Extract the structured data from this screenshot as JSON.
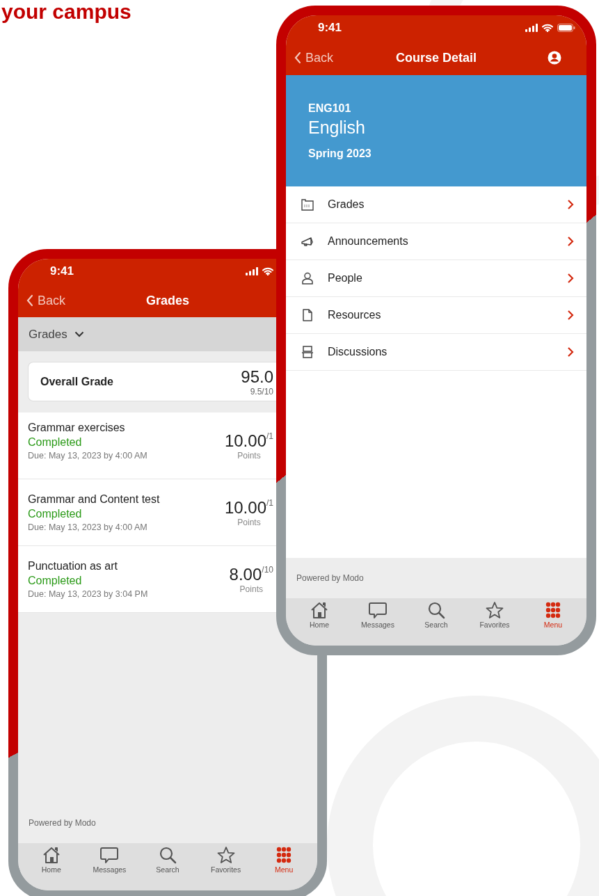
{
  "headline": "your campus",
  "course_screen": {
    "status_time": "9:41",
    "nav": {
      "back": "Back",
      "title": "Course Detail"
    },
    "course": {
      "code": "ENG101",
      "name": "English",
      "term": "Spring 2023"
    },
    "menu": [
      {
        "kind": "grades",
        "label": "Grades"
      },
      {
        "kind": "announcements",
        "label": "Announcements"
      },
      {
        "kind": "people",
        "label": "People"
      },
      {
        "kind": "resources",
        "label": "Resources"
      },
      {
        "kind": "discussions",
        "label": "Discussions"
      }
    ],
    "footer": "Powered by Modo",
    "tabs": [
      {
        "kind": "home",
        "label": "Home",
        "selected": false
      },
      {
        "kind": "messages",
        "label": "Messages",
        "selected": false
      },
      {
        "kind": "search",
        "label": "Search",
        "selected": false
      },
      {
        "kind": "favorites",
        "label": "Favorites",
        "selected": false
      },
      {
        "kind": "menu",
        "label": "Menu",
        "selected": true
      }
    ]
  },
  "grades_screen": {
    "status_time": "9:41",
    "nav": {
      "back": "Back",
      "title": "Grades"
    },
    "filter": {
      "label": "Grades"
    },
    "overall": {
      "label": "Overall Grade",
      "score": "95.0",
      "detail": "9.5/10"
    },
    "items": [
      {
        "title": "Grammar exercises",
        "status": "Completed",
        "due": "Due: May 13, 2023 by 4:00 AM",
        "score": "10.00",
        "max": "/1",
        "unit": "Points"
      },
      {
        "title": "Grammar and Content test",
        "status": "Completed",
        "due": "Due: May 13, 2023 by 4:00 AM",
        "score": "10.00",
        "max": "/1",
        "unit": "Points"
      },
      {
        "title": "Punctuation as art",
        "status": "Completed",
        "due": "Due: May 13, 2023 by 3:04 PM",
        "score": "8.00",
        "max": "/10",
        "unit": "Points"
      }
    ],
    "footer": "Powered by Modo",
    "tabs": [
      {
        "kind": "home",
        "label": "Home",
        "selected": false
      },
      {
        "kind": "messages",
        "label": "Messages",
        "selected": false
      },
      {
        "kind": "search",
        "label": "Search",
        "selected": false
      },
      {
        "kind": "favorites",
        "label": "Favorites",
        "selected": false
      },
      {
        "kind": "menu",
        "label": "Menu",
        "selected": true
      }
    ]
  }
}
